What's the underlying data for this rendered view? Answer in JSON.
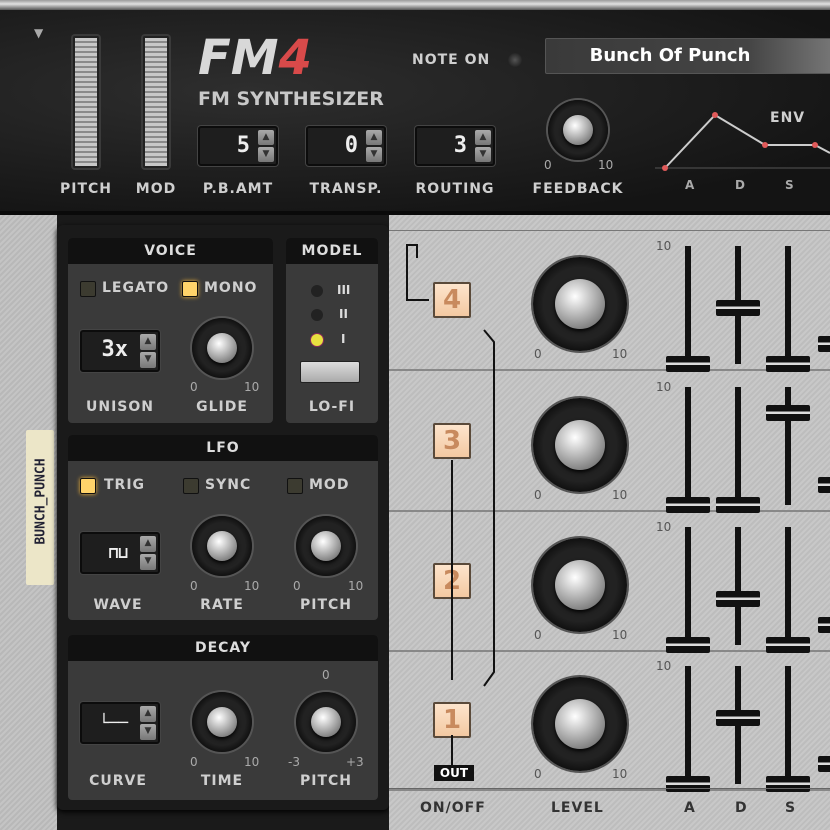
{
  "header": {
    "menu_icon": "triangle-down-icon",
    "wheels": [
      {
        "label": "PITCH"
      },
      {
        "label": "MOD"
      }
    ],
    "logo": {
      "main": "FM",
      "num": "4",
      "subtitle": "FM SYNTHESIZER"
    },
    "pb_amt": {
      "label": "P.B.AMT",
      "value": "5"
    },
    "transp": {
      "label": "TRANSP.",
      "value": "0"
    },
    "routing": {
      "label": "ROUTING",
      "value": "3"
    },
    "note_on": {
      "label": "NOTE ON"
    },
    "patch_name": "Bunch Of Punch",
    "feedback": {
      "label": "FEEDBACK",
      "min": "0",
      "max": "10",
      "value": 0.85
    },
    "env": {
      "label": "ENV",
      "segments": [
        "A",
        "D",
        "S"
      ]
    }
  },
  "tape_label": "BUNCH_PUNCH",
  "voice": {
    "title": "VOICE",
    "legato": {
      "label": "LEGATO",
      "on": false
    },
    "mono": {
      "label": "MONO",
      "on": true
    },
    "unison": {
      "label": "UNISON",
      "value": "3x"
    },
    "glide": {
      "label": "GLIDE",
      "min": "0",
      "max": "10",
      "value": 0.1
    }
  },
  "model": {
    "title": "MODEL",
    "options": [
      "III",
      "II",
      "I"
    ],
    "selected": "I",
    "lofi_label": "LO-FI"
  },
  "lfo": {
    "title": "LFO",
    "trig": {
      "label": "TRIG",
      "on": true
    },
    "sync": {
      "label": "SYNC",
      "on": false
    },
    "mod": {
      "label": "MOD",
      "on": false
    },
    "wave": {
      "label": "WAVE"
    },
    "rate": {
      "label": "RATE",
      "min": "0",
      "max": "10",
      "value": 0.55
    },
    "pitch": {
      "label": "PITCH",
      "min": "0",
      "max": "10",
      "value": 0.15
    }
  },
  "decay": {
    "title": "DECAY",
    "curve": {
      "label": "CURVE"
    },
    "time": {
      "label": "TIME",
      "min": "0",
      "max": "10",
      "value": 0.5
    },
    "pitch": {
      "label": "PITCH",
      "min": "-3",
      "max": "+3",
      "center": "0",
      "value": 0.5
    }
  },
  "operators": [
    {
      "num": "4",
      "level": 0.75,
      "a": 0,
      "d": 0.55,
      "s": 0
    },
    {
      "num": "3",
      "level": 0.75,
      "a": 0,
      "d": 0,
      "s": 0.9
    },
    {
      "num": "2",
      "level": 0.75,
      "a": 0,
      "d": 0.45,
      "s": 0
    },
    {
      "num": "1",
      "level": 0.85,
      "a": 0,
      "d": 0.65,
      "s": 0
    }
  ],
  "op_scale": {
    "min": "0",
    "max": "10",
    "slider_max": "10"
  },
  "out_label": "OUT",
  "footer": {
    "onoff": "ON/OFF",
    "level": "LEVEL",
    "a": "A",
    "d": "D",
    "s": "S"
  }
}
